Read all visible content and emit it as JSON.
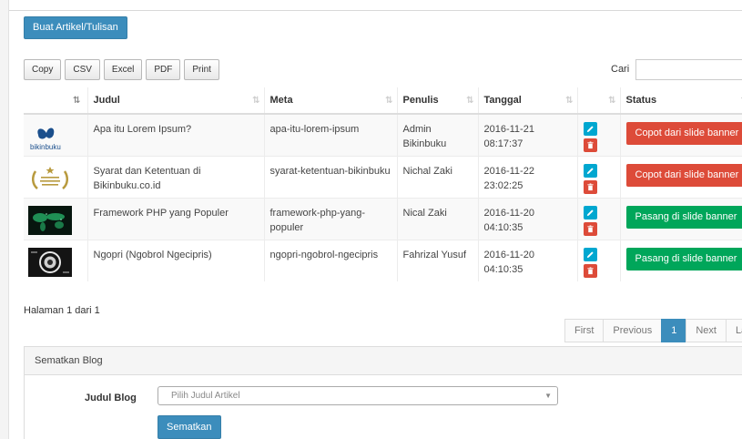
{
  "header": {
    "create_button": "Buat Artikel/Tulisan"
  },
  "toolbar": {
    "export_buttons": [
      "Copy",
      "CSV",
      "Excel",
      "PDF",
      "Print"
    ],
    "search_label": "Cari",
    "search_value": ""
  },
  "table": {
    "columns": [
      "",
      "Judul",
      "Meta",
      "Penulis",
      "Tanggal",
      "",
      "Status"
    ],
    "rows": [
      {
        "thumb_icon": "bikinbuku-logo",
        "thumb_text": "bikinbuku",
        "judul": "Apa itu Lorem Ipsum?",
        "meta": "apa-itu-lorem-ipsum",
        "penulis": "Admin Bikinbuku",
        "tanggal": "2016-11-21 08:17:37",
        "status_label": "Copot dari slide banner",
        "status_color": "#dd4b39"
      },
      {
        "thumb_icon": "award-badge",
        "thumb_text": "",
        "judul": "Syarat dan Ketentuan di Bikinbuku.co.id",
        "meta": "syarat-ketentuan-bikinbuku",
        "penulis": "Nichal Zaki",
        "tanggal": "2016-11-22 23:02:25",
        "status_label": "Copot dari slide banner",
        "status_color": "#dd4b39"
      },
      {
        "thumb_icon": "world-map-image",
        "thumb_text": "",
        "judul": "Framework PHP yang Populer",
        "meta": "framework-php-yang-populer",
        "penulis": "Nical Zaki",
        "tanggal": "2016-11-20 04:10:35",
        "status_label": "Pasang di slide banner",
        "status_color": "#00a65a"
      },
      {
        "thumb_icon": "emblem-image",
        "thumb_text": "",
        "judul": "Ngopri (Ngobrol Ngecipris)",
        "meta": "ngopri-ngobrol-ngecipris",
        "penulis": "Fahrizal Yusuf",
        "tanggal": "2016-11-20 04:10:35",
        "status_label": "Pasang di slide banner",
        "status_color": "#00a65a"
      }
    ]
  },
  "pagination": {
    "info": "Halaman 1 dari 1",
    "first": "First",
    "previous": "Previous",
    "current": "1",
    "next": "Next",
    "last": "Last"
  },
  "embed_panel": {
    "title": "Sematkan Blog",
    "field_label": "Judul Blog",
    "select_placeholder": "Pilih Judul Artikel",
    "submit_label": "Sematkan"
  },
  "colors": {
    "primary": "#3c8dbc",
    "danger": "#dd4b39",
    "success": "#00a65a",
    "info": "#00a7d0"
  }
}
